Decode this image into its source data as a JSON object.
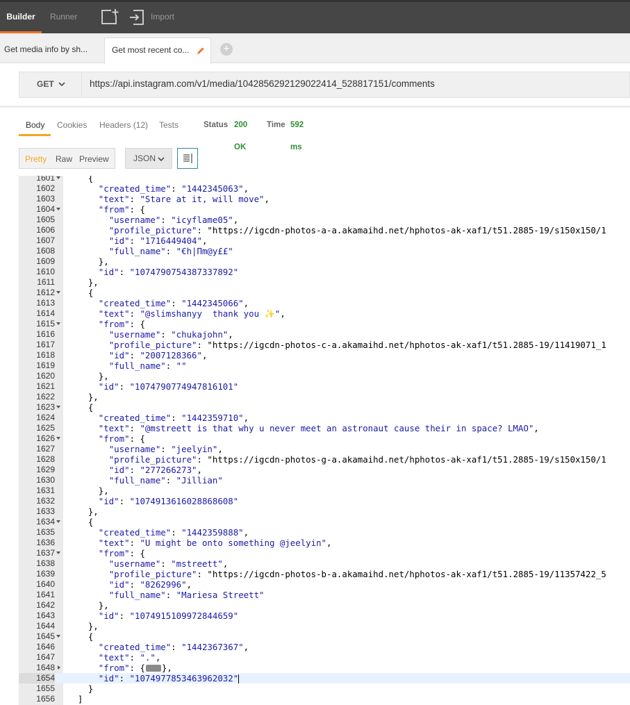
{
  "topbar": {
    "builder_label": "Builder",
    "runner_label": "Runner",
    "import_label": "Import"
  },
  "request_tabs": [
    {
      "label": "Get media info by sh..."
    },
    {
      "label": "Get most recent co..."
    }
  ],
  "request": {
    "method": "GET",
    "url": "https://api.instagram.com/v1/media/1042856292129022414_528817151/comments"
  },
  "response_tabs": {
    "body": "Body",
    "cookies": "Cookies",
    "headers": "Headers (12)",
    "tests": "Tests"
  },
  "status": {
    "status_label": "Status",
    "status_value": "200 OK",
    "time_label": "Time",
    "time_value": "592 ms"
  },
  "format": {
    "pretty": "Pretty",
    "raw": "Raw",
    "preview": "Preview",
    "language": "JSON"
  },
  "code_lines": [
    {
      "n": "1601",
      "fold": "open",
      "code": "    {"
    },
    {
      "n": "1602",
      "fold": "",
      "code": "      \"created_time\": \"1442345063\","
    },
    {
      "n": "1603",
      "fold": "",
      "code": "      \"text\": \"Stare at it, will move\","
    },
    {
      "n": "1604",
      "fold": "open",
      "code": "      \"from\": {"
    },
    {
      "n": "1605",
      "fold": "",
      "code": "        \"username\": \"icyflame05\","
    },
    {
      "n": "1606",
      "fold": "",
      "code": "        \"profile_picture\": \"https://igcdn-photos-a-a.akamaihd.net/hphotos-ak-xaf1/t51.2885-19/s150x150/1"
    },
    {
      "n": "1607",
      "fold": "",
      "code": "        \"id\": \"1716449404\","
    },
    {
      "n": "1608",
      "fold": "",
      "code": "        \"full_name\": \"€h|Πm@y££\""
    },
    {
      "n": "1609",
      "fold": "",
      "code": "      },"
    },
    {
      "n": "1610",
      "fold": "",
      "code": "      \"id\": \"1074790754387337892\""
    },
    {
      "n": "1611",
      "fold": "",
      "code": "    },"
    },
    {
      "n": "1612",
      "fold": "open",
      "code": "    {"
    },
    {
      "n": "1613",
      "fold": "",
      "code": "      \"created_time\": \"1442345066\","
    },
    {
      "n": "1614",
      "fold": "",
      "code": "      \"text\": \"@slimshanyy  thank you ✨\","
    },
    {
      "n": "1615",
      "fold": "open",
      "code": "      \"from\": {"
    },
    {
      "n": "1616",
      "fold": "",
      "code": "        \"username\": \"chukajohn\","
    },
    {
      "n": "1617",
      "fold": "",
      "code": "        \"profile_picture\": \"https://igcdn-photos-c-a.akamaihd.net/hphotos-ak-xaf1/t51.2885-19/11419071_1"
    },
    {
      "n": "1618",
      "fold": "",
      "code": "        \"id\": \"2007128366\","
    },
    {
      "n": "1619",
      "fold": "",
      "code": "        \"full_name\": \"\""
    },
    {
      "n": "1620",
      "fold": "",
      "code": "      },"
    },
    {
      "n": "1621",
      "fold": "",
      "code": "      \"id\": \"1074790774947816101\""
    },
    {
      "n": "1622",
      "fold": "",
      "code": "    },"
    },
    {
      "n": "1623",
      "fold": "open",
      "code": "    {"
    },
    {
      "n": "1624",
      "fold": "",
      "code": "      \"created_time\": \"1442359710\","
    },
    {
      "n": "1625",
      "fold": "",
      "code": "      \"text\": \"@mstreett is that why u never meet an astronaut cause their in space? LMAO\","
    },
    {
      "n": "1626",
      "fold": "open",
      "code": "      \"from\": {"
    },
    {
      "n": "1627",
      "fold": "",
      "code": "        \"username\": \"jeelyin\","
    },
    {
      "n": "1628",
      "fold": "",
      "code": "        \"profile_picture\": \"https://igcdn-photos-g-a.akamaihd.net/hphotos-ak-xaf1/t51.2885-19/s150x150/1"
    },
    {
      "n": "1629",
      "fold": "",
      "code": "        \"id\": \"277266273\","
    },
    {
      "n": "1630",
      "fold": "",
      "code": "        \"full_name\": \"Jillian\""
    },
    {
      "n": "1631",
      "fold": "",
      "code": "      },"
    },
    {
      "n": "1632",
      "fold": "",
      "code": "      \"id\": \"1074913616028868608\""
    },
    {
      "n": "1633",
      "fold": "",
      "code": "    },"
    },
    {
      "n": "1634",
      "fold": "open",
      "code": "    {"
    },
    {
      "n": "1635",
      "fold": "",
      "code": "      \"created_time\": \"1442359888\","
    },
    {
      "n": "1636",
      "fold": "",
      "code": "      \"text\": \"U might be onto something @jeelyin\","
    },
    {
      "n": "1637",
      "fold": "open",
      "code": "      \"from\": {"
    },
    {
      "n": "1638",
      "fold": "",
      "code": "        \"username\": \"mstreett\","
    },
    {
      "n": "1639",
      "fold": "",
      "code": "        \"profile_picture\": \"https://igcdn-photos-b-a.akamaihd.net/hphotos-ak-xaf1/t51.2885-19/11357422_5"
    },
    {
      "n": "1640",
      "fold": "",
      "code": "        \"id\": \"8262996\","
    },
    {
      "n": "1641",
      "fold": "",
      "code": "        \"full_name\": \"Mariesa Streett\""
    },
    {
      "n": "1642",
      "fold": "",
      "code": "      },"
    },
    {
      "n": "1643",
      "fold": "",
      "code": "      \"id\": \"1074915109972844659\""
    },
    {
      "n": "1644",
      "fold": "",
      "code": "    },"
    },
    {
      "n": "1645",
      "fold": "open",
      "code": "    {"
    },
    {
      "n": "1646",
      "fold": "",
      "code": "      \"created_time\": \"1442367367\","
    },
    {
      "n": "1647",
      "fold": "",
      "code": "      \"text\": \".\","
    },
    {
      "n": "1648",
      "fold": "closed",
      "code": "      \"from\": {⋯},"
    },
    {
      "n": "1654",
      "fold": "",
      "code": "      \"id\": \"1074977853463962032\"",
      "active": true
    },
    {
      "n": "1655",
      "fold": "",
      "code": "    }"
    },
    {
      "n": "1656",
      "fold": "",
      "code": "  ]"
    }
  ]
}
